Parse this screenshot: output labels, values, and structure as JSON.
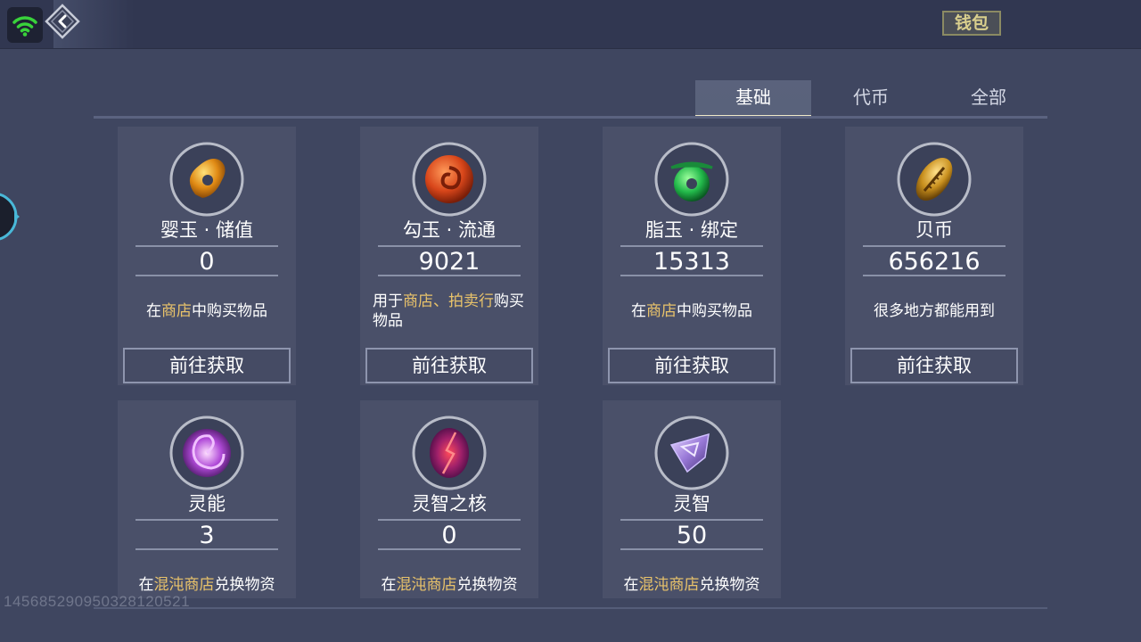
{
  "header": {
    "wallet_label": "钱包"
  },
  "tabs": [
    {
      "label": "基础",
      "active": true
    },
    {
      "label": "代币",
      "active": false
    },
    {
      "label": "全部",
      "active": false
    }
  ],
  "currencies": [
    {
      "name": "婴玉 · 储值",
      "value": "0",
      "desc_pre": "在",
      "desc_hl": "商店",
      "desc_post": "中购买物品",
      "button": "前往获取",
      "icon": "orange-jade-icon"
    },
    {
      "name": "勾玉 · 流通",
      "value": "9021",
      "desc_pre": "用于",
      "desc_hl": "商店、拍卖行",
      "desc_post": "购买物品",
      "button": "前往获取",
      "icon": "red-spiral-jade-icon"
    },
    {
      "name": "脂玉 · 绑定",
      "value": "15313",
      "desc_pre": "在",
      "desc_hl": "商店",
      "desc_post": "中购买物品",
      "button": "前往获取",
      "icon": "green-jade-icon"
    },
    {
      "name": "贝币",
      "value": "656216",
      "desc_pre": "很多地方都能用到",
      "desc_hl": "",
      "desc_post": "",
      "button": "前往获取",
      "icon": "golden-shell-icon"
    },
    {
      "name": "灵能",
      "value": "3",
      "desc_pre": "在",
      "desc_hl": "混沌商店",
      "desc_post": "兑换物资",
      "icon": "spirit-vortex-icon"
    },
    {
      "name": "灵智之核",
      "value": "0",
      "desc_pre": "在",
      "desc_hl": "混沌商店",
      "desc_post": "兑换物资",
      "icon": "crimson-core-icon"
    },
    {
      "name": "灵智",
      "value": "50",
      "desc_pre": "在",
      "desc_hl": "混沌商店",
      "desc_post": "兑换物资",
      "icon": "purple-crystal-icon"
    }
  ],
  "watermark": "145685290950328120521",
  "colors": {
    "background": "#3f4660",
    "card": "#4a5069",
    "highlight": "#e8c26a",
    "wifi": "#39d23b"
  }
}
